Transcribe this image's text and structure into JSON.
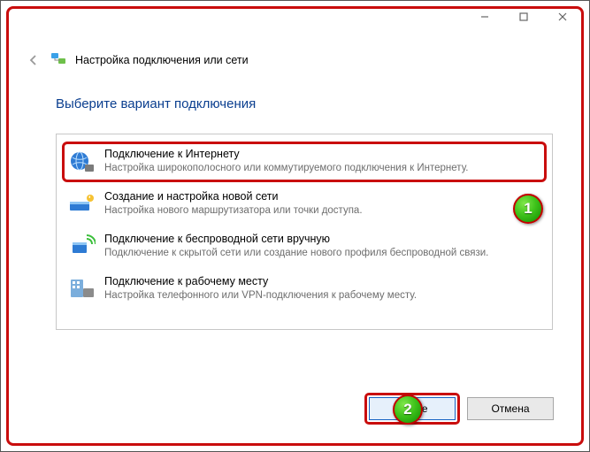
{
  "titlebar": {
    "minimize": "–",
    "maximize": "□",
    "close": "×"
  },
  "header": {
    "wizard_title": "Настройка подключения или сети"
  },
  "heading": "Выберите вариант подключения",
  "options": [
    {
      "title": "Подключение к Интернету",
      "desc": "Настройка широкополосного или коммутируемого подключения к Интернету."
    },
    {
      "title": "Создание и настройка новой сети",
      "desc": "Настройка нового маршрутизатора или точки доступа."
    },
    {
      "title": "Подключение к беспроводной сети вручную",
      "desc": "Подключение к скрытой сети или создание нового профиля беспроводной связи."
    },
    {
      "title": "Подключение к рабочему месту",
      "desc": "Настройка телефонного или VPN-подключения к рабочему месту."
    }
  ],
  "footer": {
    "next": "Далее",
    "cancel": "Отмена"
  },
  "callouts": {
    "one": "1",
    "two": "2"
  }
}
